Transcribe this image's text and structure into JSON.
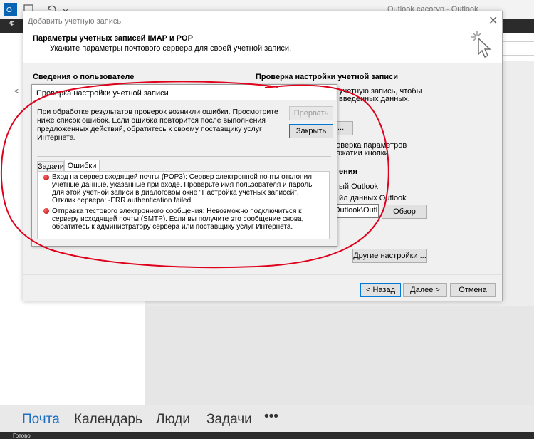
{
  "outlook": {
    "window_title": "Outlook сасогуp - Outlook",
    "ribbon_file": "Ф",
    "nav": {
      "mail": "Почта",
      "calendar": "Календарь",
      "people": "Люди",
      "tasks": "Задачи",
      "more": "•••"
    },
    "status": "Готово"
  },
  "dialog": {
    "title": "Добавить учетную запись",
    "heading": "Параметры учетных записей IMAP и POP",
    "subheading": "Укажите параметры почтового сервера для своей учетной записи.",
    "section_user": "Сведения о пользователе",
    "section_test": "Проверка настройки учетной записи",
    "bg_text_1": "учетную запись, чтобы",
    "bg_text_2": "введенных данных.",
    "bg_button": "...",
    "bg_text_3": "роверка параметров",
    "bg_text_4": "нажатии кнопки",
    "bg_text_5": "ения",
    "bg_text_6": "ый Outlook",
    "bg_text_7": "йл данных Outlook",
    "path_value": "Outlook\\Outl",
    "browse_label": "Обзор",
    "more_settings_label": "Другие настройки ...",
    "back_label": "< Назад",
    "next_label": "Далее >",
    "cancel_label": "Отмена",
    "close_glyph": "✕"
  },
  "test_dialog": {
    "title": "Проверка настройки учетной записи",
    "message": "При обработке результатов проверок возникли ошибки. Просмотрите ниже список ошибок. Если ошибка повторится после выполнения предложенных действий, обратитесь к своему поставщику услуг Интернета.",
    "stop_label": "Прервать",
    "close_label": "Закрыть",
    "tabs": [
      "Задачи",
      "Ошибки"
    ],
    "errors": [
      "Вход на сервер входящей почты (POP3): Сервер электронной почты отклонил учетные данные, указанные при входе. Проверьте имя пользователя и пароль для этой учетной записи в диалоговом окне \"Настройка учетных записей\". Отклик сервера: -ERR authentication failed",
      "Отправка тестового электронного сообщения: Невозможно подключиться к серверу исходящей почты (SMTP). Если вы получите это сообщение снова, обратитесь к администратору сервера или поставщику услуг Интернета."
    ]
  },
  "colors": {
    "accent": "#0078d7",
    "annotation": "#e0001b",
    "nav_active": "#1e6fc2"
  }
}
